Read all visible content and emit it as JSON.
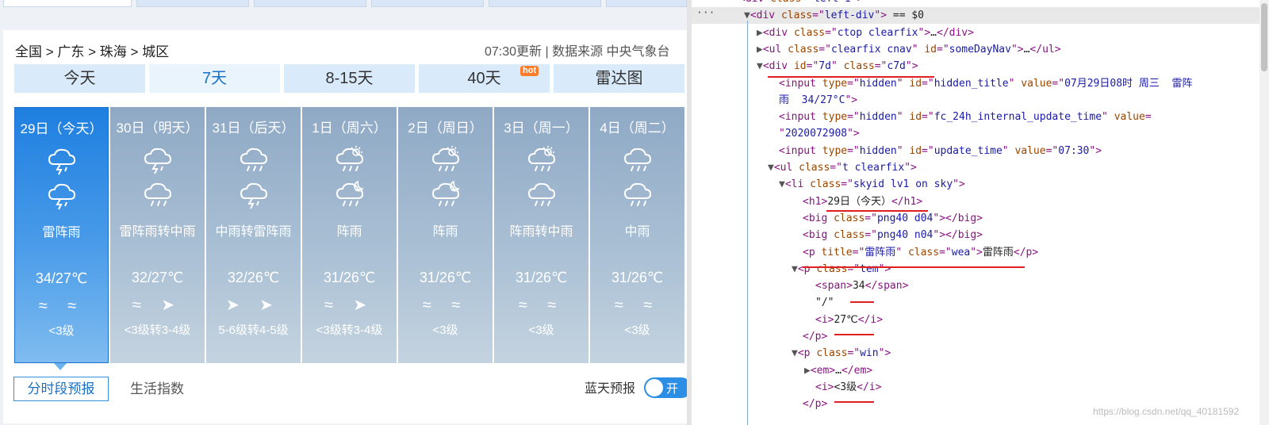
{
  "breadcrumb": "全国 > 广东 > 珠海 > 城区",
  "update_info": "07:30更新 | 数据来源 中央气象台",
  "nav_tabs": [
    {
      "label": "今天"
    },
    {
      "label": "7天"
    },
    {
      "label": "8-15天"
    },
    {
      "label": "40天"
    },
    {
      "label": "雷达图"
    }
  ],
  "hot_badge": "hot",
  "days": [
    {
      "date": "29日（今天）",
      "weather": "雷阵雨",
      "temp": "34/27℃",
      "wind": "≈ ≈",
      "level": "<3级",
      "icon_day": "thunder-rain-icon",
      "icon_night": "thunder-rain-icon"
    },
    {
      "date": "30日（明天）",
      "weather": "雷阵雨转中雨",
      "temp": "32/27℃",
      "wind": "≈ ➤",
      "level": "<3级转3-4级",
      "icon_day": "thunder-rain-icon",
      "icon_night": "rain-icon"
    },
    {
      "date": "31日（后天）",
      "weather": "中雨转雷阵雨",
      "temp": "32/26℃",
      "wind": "➤ ➤",
      "level": "5-6级转4-5级",
      "icon_day": "rain-icon",
      "icon_night": "thunder-rain-icon"
    },
    {
      "date": "1日（周六）",
      "weather": "阵雨",
      "temp": "31/26℃",
      "wind": "≈ ➤",
      "level": "<3级转3-4级",
      "icon_day": "sun-rain-icon",
      "icon_night": "moon-rain-icon"
    },
    {
      "date": "2日（周日）",
      "weather": "阵雨",
      "temp": "31/26℃",
      "wind": "≈ ≈",
      "level": "<3级",
      "icon_day": "sun-rain-icon",
      "icon_night": "moon-rain-icon"
    },
    {
      "date": "3日（周一）",
      "weather": "阵雨转中雨",
      "temp": "31/26℃",
      "wind": "≈ ≈",
      "level": "<3级",
      "icon_day": "sun-rain-icon",
      "icon_night": "rain-icon"
    },
    {
      "date": "4日（周二）",
      "weather": "中雨",
      "temp": "31/26℃",
      "wind": "≈ ≈",
      "level": "<3级",
      "icon_day": "rain-icon",
      "icon_night": "rain-icon"
    }
  ],
  "sub_tabs": [
    "分时段预报",
    "生活指数"
  ],
  "sky_forecast_label": "蓝天预报",
  "toggle_label": "开",
  "devtools": {
    "dots": "···",
    "lines": [
      {
        "indent": 60,
        "arrow": "",
        "parts": [
          [
            "tag",
            "<div "
          ],
          [
            "an",
            "class"
          ],
          [
            "tag",
            "=\""
          ],
          [
            "av",
            "left-i"
          ],
          [
            "tag",
            "\">"
          ]
        ]
      },
      {
        "indent": 66,
        "arrow": "▼",
        "parts": [
          [
            "tag",
            "<div "
          ],
          [
            "an",
            "class"
          ],
          [
            "tag",
            "=\""
          ],
          [
            "av",
            "left-div"
          ],
          [
            "tag",
            "\">"
          ],
          [
            "tx",
            " == $0"
          ]
        ]
      },
      {
        "indent": 82,
        "arrow": "▶",
        "parts": [
          [
            "tag",
            "<div "
          ],
          [
            "an",
            "class"
          ],
          [
            "tag",
            "=\""
          ],
          [
            "av",
            "ctop clearfix"
          ],
          [
            "tag",
            "\">"
          ],
          [
            "tx",
            "…"
          ],
          [
            "tag",
            "</div>"
          ]
        ]
      },
      {
        "indent": 82,
        "arrow": "▶",
        "parts": [
          [
            "tag",
            "<ul "
          ],
          [
            "an",
            "class"
          ],
          [
            "tag",
            "=\""
          ],
          [
            "av",
            "clearfix cnav"
          ],
          [
            "tag",
            "\" "
          ],
          [
            "an",
            "id"
          ],
          [
            "tag",
            "=\""
          ],
          [
            "av",
            "someDayNav"
          ],
          [
            "tag",
            "\">"
          ],
          [
            "tx",
            "…"
          ],
          [
            "tag",
            "</ul>"
          ]
        ]
      },
      {
        "indent": 82,
        "arrow": "▼",
        "parts": [
          [
            "tag",
            "<div "
          ],
          [
            "an",
            "id"
          ],
          [
            "tag",
            "=\""
          ],
          [
            "av",
            "7d"
          ],
          [
            "tag",
            "\" "
          ],
          [
            "an",
            "class"
          ],
          [
            "tag",
            "=\""
          ],
          [
            "av",
            "c7d"
          ],
          [
            "tag",
            "\">"
          ]
        ]
      },
      {
        "indent": 110,
        "arrow": "",
        "parts": [
          [
            "tag",
            "<input "
          ],
          [
            "an",
            "type"
          ],
          [
            "tag",
            "=\""
          ],
          [
            "av",
            "hidden"
          ],
          [
            "tag",
            "\" "
          ],
          [
            "an",
            "id"
          ],
          [
            "tag",
            "=\""
          ],
          [
            "av",
            "hidden_title"
          ],
          [
            "tag",
            "\" "
          ],
          [
            "an",
            "value"
          ],
          [
            "tag",
            "=\""
          ],
          [
            "av",
            "07月29日08时 周三  雷阵"
          ]
        ]
      },
      {
        "indent": 110,
        "arrow": "",
        "parts": [
          [
            "av",
            "雨  34/27°C"
          ],
          [
            "tag",
            "\">"
          ]
        ]
      },
      {
        "indent": 110,
        "arrow": "",
        "parts": [
          [
            "tag",
            "<input "
          ],
          [
            "an",
            "type"
          ],
          [
            "tag",
            "=\""
          ],
          [
            "av",
            "hidden"
          ],
          [
            "tag",
            "\" "
          ],
          [
            "an",
            "id"
          ],
          [
            "tag",
            "=\""
          ],
          [
            "av",
            "fc_24h_internal_update_time"
          ],
          [
            "tag",
            "\" "
          ],
          [
            "an",
            "value"
          ],
          [
            "tag",
            "="
          ]
        ]
      },
      {
        "indent": 110,
        "arrow": "",
        "parts": [
          [
            "tag",
            "\""
          ],
          [
            "av",
            "2020072908"
          ],
          [
            "tag",
            "\">"
          ]
        ]
      },
      {
        "indent": 110,
        "arrow": "",
        "parts": [
          [
            "tag",
            "<input "
          ],
          [
            "an",
            "type"
          ],
          [
            "tag",
            "=\""
          ],
          [
            "av",
            "hidden"
          ],
          [
            "tag",
            "\" "
          ],
          [
            "an",
            "id"
          ],
          [
            "tag",
            "=\""
          ],
          [
            "av",
            "update_time"
          ],
          [
            "tag",
            "\" "
          ],
          [
            "an",
            "value"
          ],
          [
            "tag",
            "=\""
          ],
          [
            "av",
            "07:30"
          ],
          [
            "tag",
            "\">"
          ]
        ]
      },
      {
        "indent": 96,
        "arrow": "▼",
        "parts": [
          [
            "tag",
            "<ul "
          ],
          [
            "an",
            "class"
          ],
          [
            "tag",
            "=\""
          ],
          [
            "av",
            "t clearfix"
          ],
          [
            "tag",
            "\">"
          ]
        ]
      },
      {
        "indent": 110,
        "arrow": "▼",
        "parts": [
          [
            "tag",
            "<li "
          ],
          [
            "an",
            "class"
          ],
          [
            "tag",
            "=\""
          ],
          [
            "av",
            "skyid lv1 on sky"
          ],
          [
            "tag",
            "\">"
          ]
        ]
      },
      {
        "indent": 140,
        "arrow": "",
        "parts": [
          [
            "tag",
            "<h1>"
          ],
          [
            "tx",
            "29日（今天）"
          ],
          [
            "tag",
            "</h1>"
          ]
        ]
      },
      {
        "indent": 140,
        "arrow": "",
        "parts": [
          [
            "tag",
            "<big "
          ],
          [
            "an",
            "class"
          ],
          [
            "tag",
            "=\""
          ],
          [
            "av",
            "png40 d04"
          ],
          [
            "tag",
            "\"></big>"
          ]
        ]
      },
      {
        "indent": 140,
        "arrow": "",
        "parts": [
          [
            "tag",
            "<big "
          ],
          [
            "an",
            "class"
          ],
          [
            "tag",
            "=\""
          ],
          [
            "av",
            "png40 n04"
          ],
          [
            "tag",
            "\"></big>"
          ]
        ]
      },
      {
        "indent": 140,
        "arrow": "",
        "parts": [
          [
            "tag",
            "<p "
          ],
          [
            "an",
            "title"
          ],
          [
            "tag",
            "=\""
          ],
          [
            "av",
            "雷阵雨"
          ],
          [
            "tag",
            "\" "
          ],
          [
            "an",
            "class"
          ],
          [
            "tag",
            "=\""
          ],
          [
            "av",
            "wea"
          ],
          [
            "tag",
            "\">"
          ],
          [
            "tx",
            "雷阵雨"
          ],
          [
            "tag",
            "</p>"
          ]
        ]
      },
      {
        "indent": 126,
        "arrow": "▼",
        "parts": [
          [
            "tag",
            "<p "
          ],
          [
            "an",
            "class"
          ],
          [
            "tag",
            "=\""
          ],
          [
            "av",
            "tem"
          ],
          [
            "tag",
            "\">"
          ]
        ]
      },
      {
        "indent": 156,
        "arrow": "",
        "parts": [
          [
            "tag",
            "<span>"
          ],
          [
            "tx",
            "34"
          ],
          [
            "tag",
            "</span>"
          ]
        ]
      },
      {
        "indent": 156,
        "arrow": "",
        "parts": [
          [
            "tx",
            "\"/\""
          ]
        ]
      },
      {
        "indent": 156,
        "arrow": "",
        "parts": [
          [
            "tag",
            "<i>"
          ],
          [
            "tx",
            "27℃"
          ],
          [
            "tag",
            "</i>"
          ]
        ]
      },
      {
        "indent": 140,
        "arrow": "",
        "parts": [
          [
            "tag",
            "</p>"
          ]
        ]
      },
      {
        "indent": 126,
        "arrow": "▼",
        "parts": [
          [
            "tag",
            "<p "
          ],
          [
            "an",
            "class"
          ],
          [
            "tag",
            "=\""
          ],
          [
            "av",
            "win"
          ],
          [
            "tag",
            "\">"
          ]
        ]
      },
      {
        "indent": 142,
        "arrow": "▶",
        "parts": [
          [
            "tag",
            "<em>"
          ],
          [
            "tx",
            "…"
          ],
          [
            "tag",
            "</em>"
          ]
        ]
      },
      {
        "indent": 156,
        "arrow": "",
        "parts": [
          [
            "tag",
            "<i>"
          ],
          [
            "tx",
            "<3级"
          ],
          [
            "tag",
            "</i>"
          ]
        ]
      },
      {
        "indent": 140,
        "arrow": "",
        "parts": [
          [
            "tag",
            "</p>"
          ]
        ]
      }
    ]
  },
  "watermark": "https://blog.csdn.net/qq_40181592",
  "colors": {
    "selected_day": "#1e7fe0",
    "accent": "#1a70c7",
    "underline": "#e02020"
  }
}
